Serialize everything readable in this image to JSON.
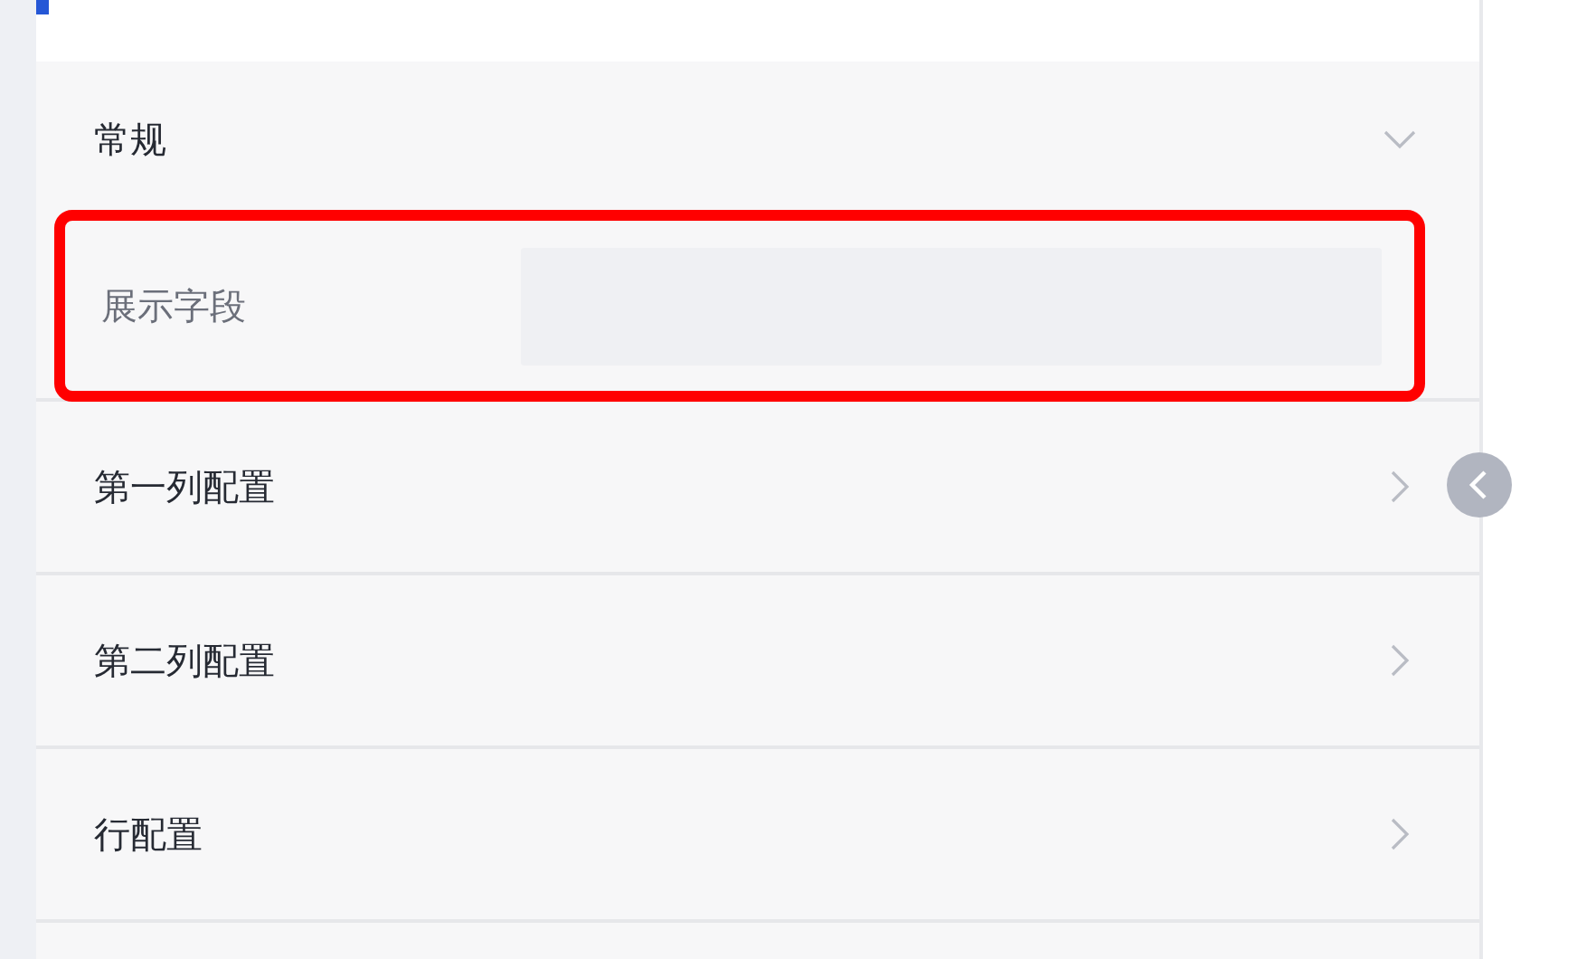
{
  "group": {
    "label": "常规",
    "expanded": true,
    "fields": [
      {
        "label": "展示字段",
        "highlighted": true
      }
    ]
  },
  "sections": [
    {
      "label": "第一列配置",
      "expanded": false
    },
    {
      "label": "第二列配置",
      "expanded": false
    },
    {
      "label": "行配置",
      "expanded": false
    }
  ],
  "panel": {
    "collapsed": false
  }
}
